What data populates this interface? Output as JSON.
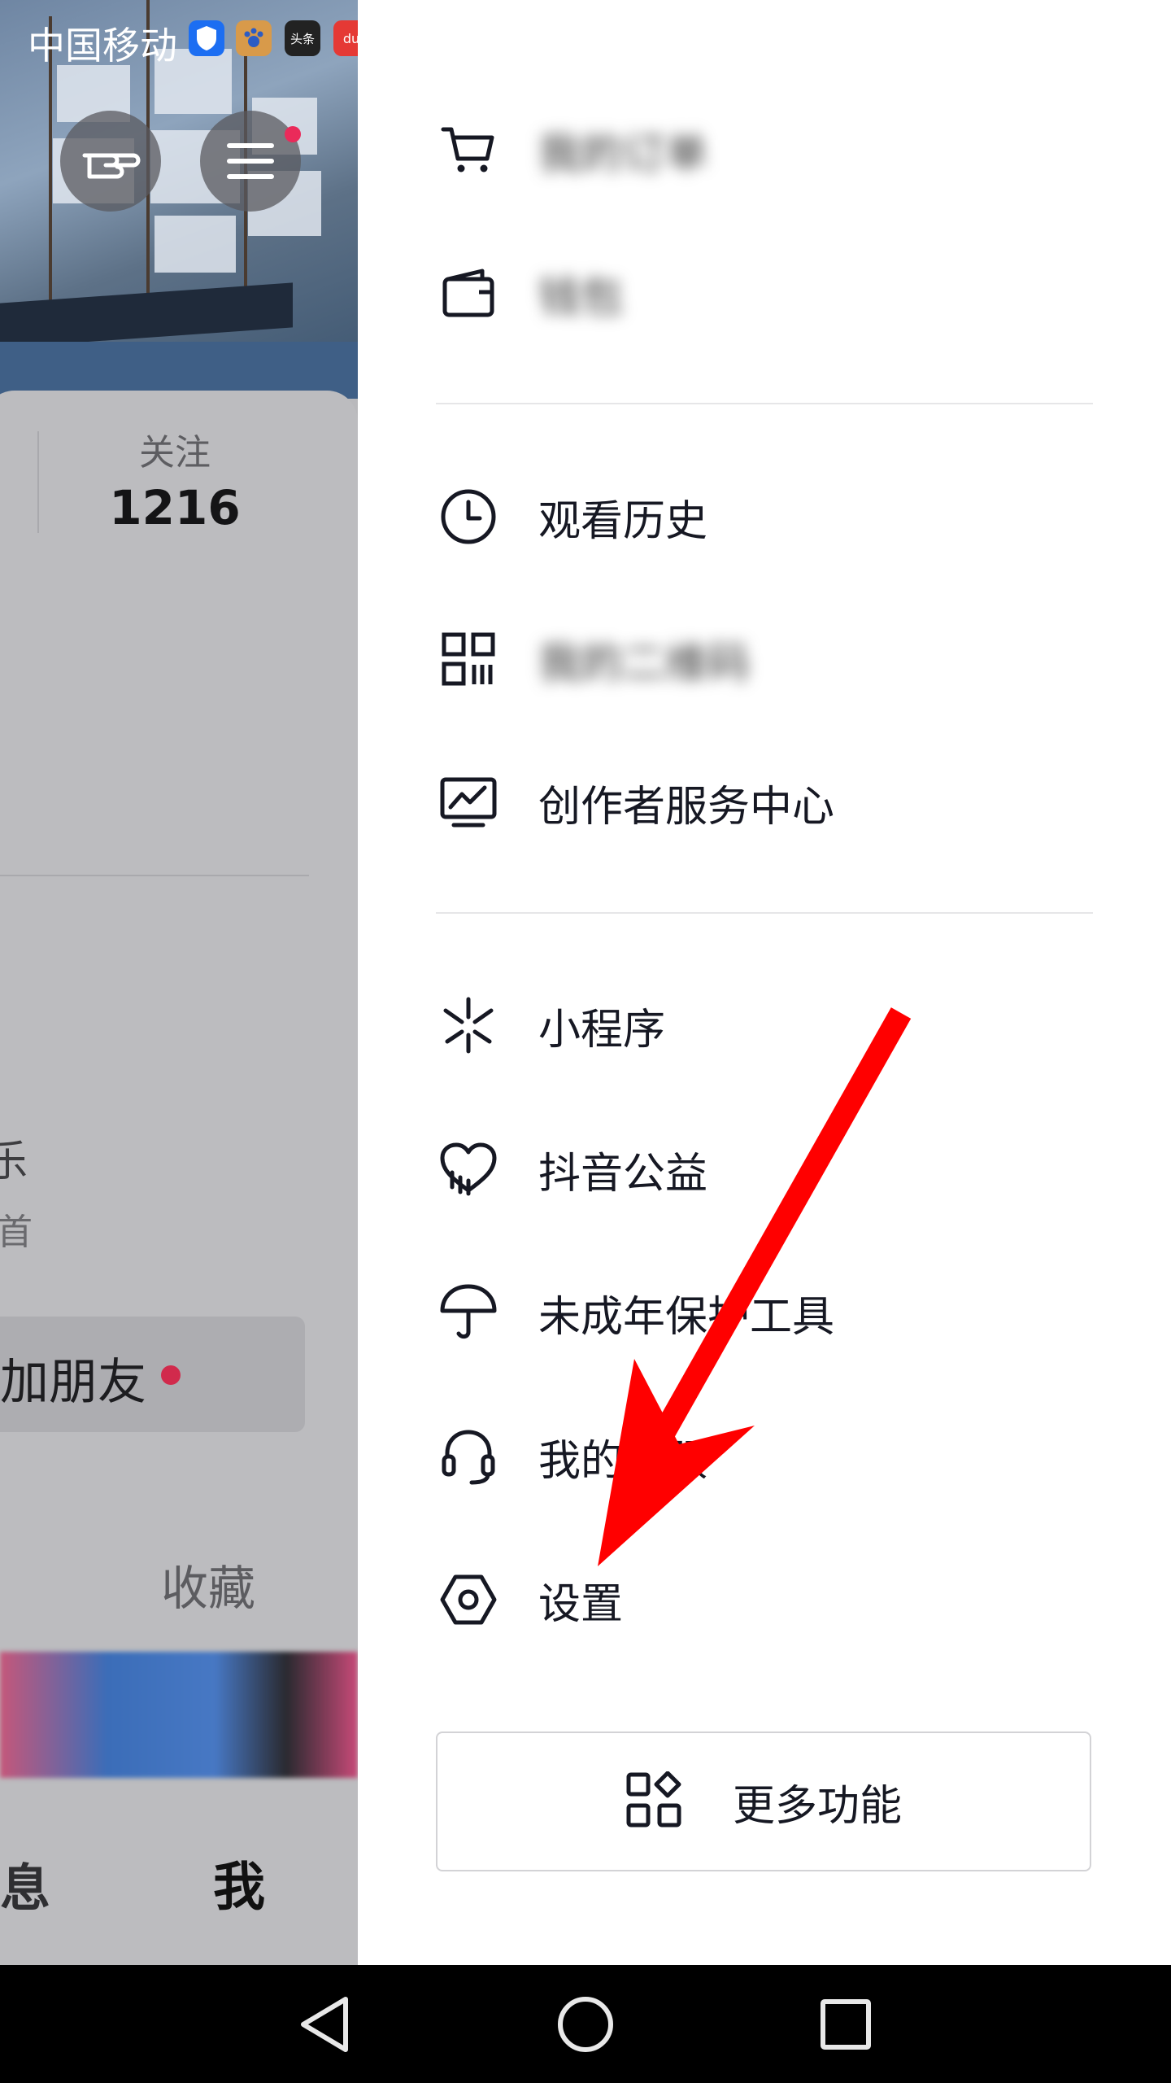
{
  "status_bar": {
    "carrier": "中国移动",
    "app_icons": [
      "shield-icon",
      "paw-icon",
      "toutiao-icon",
      "baidu-map-icon"
    ],
    "toutiao_text": "头条",
    "baidu_text": "du"
  },
  "background_page": {
    "stats": {
      "following_label": "关注",
      "following_value": "1216"
    },
    "partial_text_1": "乐",
    "partial_text_2": "首",
    "add_friend_label": "加朋友",
    "favorites_tab": "收藏",
    "bottom_tabs": {
      "messages": "息",
      "me": "我"
    }
  },
  "drawer": {
    "group1": [
      {
        "icon": "cart-icon",
        "label": "我的订单",
        "blurred": true
      },
      {
        "icon": "wallet-icon",
        "label": "钱包",
        "blurred": true
      }
    ],
    "group2": [
      {
        "icon": "clock-icon",
        "label": "观看历史",
        "blurred": false
      },
      {
        "icon": "qrcode-icon",
        "label": "我的二维码",
        "blurred": true
      },
      {
        "icon": "creator-chart-icon",
        "label": "创作者服务中心",
        "blurred": false
      }
    ],
    "group3": [
      {
        "icon": "mini-program-icon",
        "label": "小程序",
        "blurred": false
      },
      {
        "icon": "heart-charity-icon",
        "label": "抖音公益",
        "blurred": false
      },
      {
        "icon": "umbrella-icon",
        "label": "未成年保护工具",
        "blurred": false
      },
      {
        "icon": "headset-icon",
        "label": "我的客服",
        "blurred": false
      },
      {
        "icon": "settings-hexagon-icon",
        "label": "设置",
        "blurred": false
      }
    ],
    "more_button": {
      "icon": "grid-shapes-icon",
      "label": "更多功能"
    }
  },
  "system_nav": [
    "back-icon",
    "home-icon",
    "recents-icon"
  ],
  "annotation": {
    "color": "#ff0000"
  }
}
